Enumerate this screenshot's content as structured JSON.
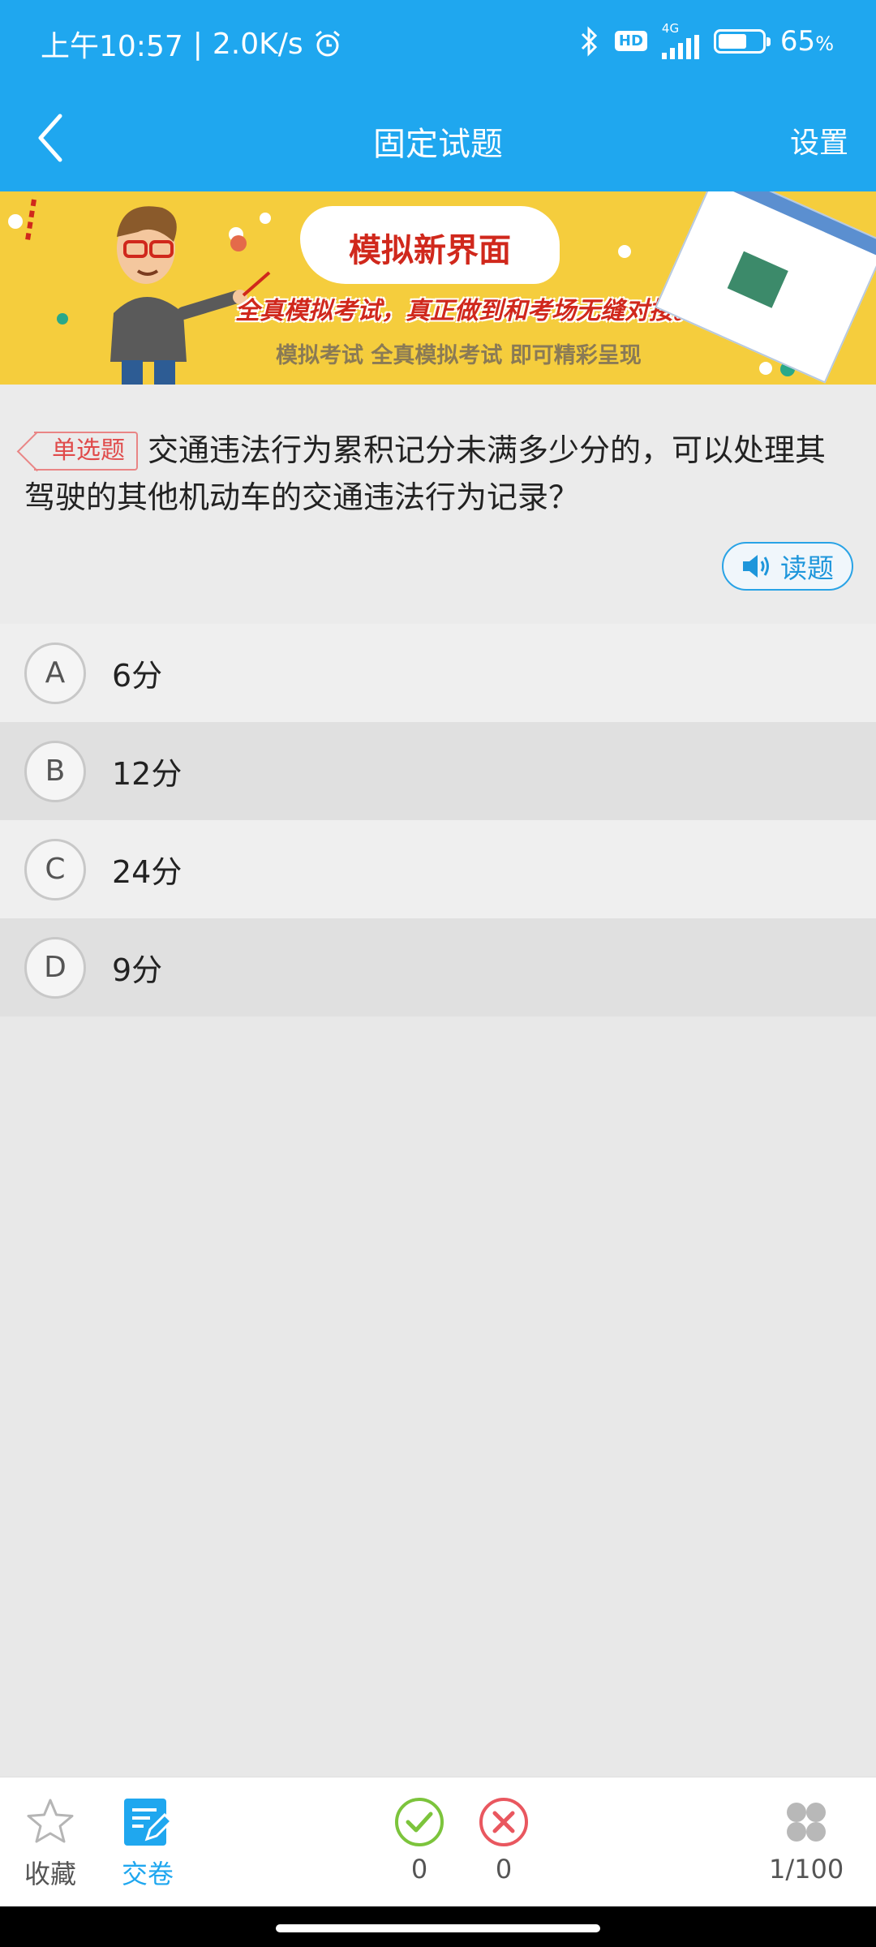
{
  "status_bar": {
    "time": "上午10:57",
    "separator": "|",
    "network_speed": "2.0K/s",
    "hd": "HD",
    "network_type": "4G",
    "battery_percent": "65",
    "battery_unit": "%",
    "battery_level": 0.65
  },
  "app_bar": {
    "title": "固定试题",
    "settings_label": "设置"
  },
  "banner": {
    "headline": "模拟新界面",
    "subline": "全真模拟考试，真正做到和考场无缝对接。",
    "caption": "模拟考试 全真模拟考试 即可精彩呈现"
  },
  "question": {
    "type_tag": "单选题",
    "text": "交通违法行为累积记分未满多少分的，可以处理其驾驶的其他机动车的交通违法行为记录？",
    "read_label": "读题"
  },
  "options": [
    {
      "letter": "A",
      "text": "6分"
    },
    {
      "letter": "B",
      "text": "12分"
    },
    {
      "letter": "C",
      "text": "24分"
    },
    {
      "letter": "D",
      "text": "9分"
    }
  ],
  "bottom_bar": {
    "favorite_label": "收藏",
    "submit_label": "交卷",
    "correct_count": "0",
    "wrong_count": "0",
    "progress": "1/100"
  },
  "colors": {
    "primary": "#1fa7ef",
    "correct": "#7cc43c",
    "wrong": "#e9575f",
    "tag": "#e04b4b"
  }
}
